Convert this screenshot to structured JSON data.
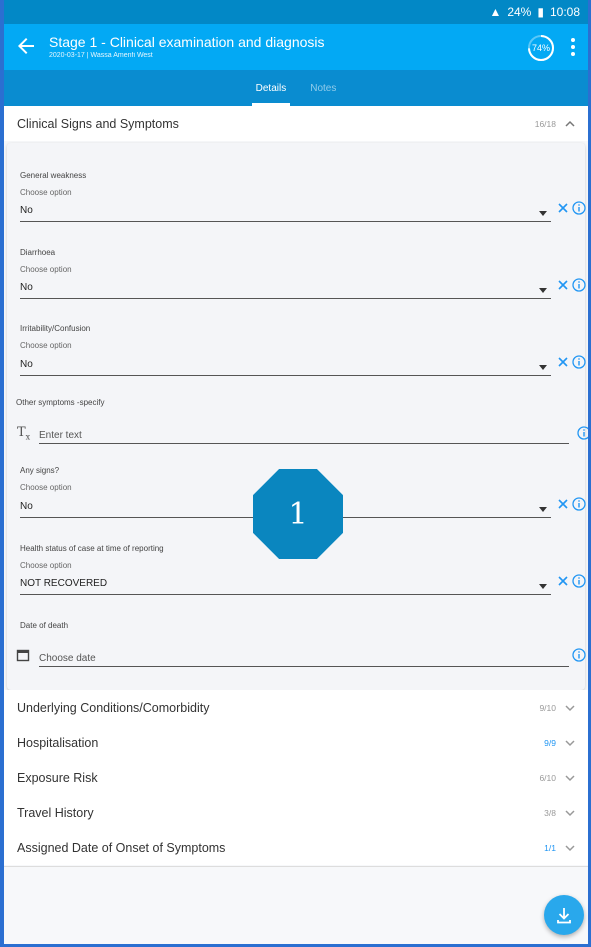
{
  "status_bar": {
    "battery": "24%",
    "time": "10:08"
  },
  "app_bar": {
    "title": "Stage 1 - Clinical examination and diagnosis",
    "subtitle": "2020-03-17 | Wassa Amenfi West",
    "progress": "74%"
  },
  "tabs": [
    {
      "label": "Details"
    },
    {
      "label": "Notes"
    }
  ],
  "sections": {
    "clinical": {
      "title": "Clinical Signs and Symptoms",
      "count": "16/18"
    },
    "underlying": {
      "title": "Underlying Conditions/Comorbidity",
      "count": "9/10"
    },
    "hospitalisation": {
      "title": "Hospitalisation",
      "count": "9/9"
    },
    "exposure": {
      "title": "Exposure Risk",
      "count": "6/10"
    },
    "travel": {
      "title": "Travel History",
      "count": "3/8"
    },
    "onset": {
      "title": "Assigned Date of Onset of Symptoms",
      "count": "1/1"
    }
  },
  "fields": {
    "weakness": {
      "label": "General weakness",
      "sublabel": "Choose option",
      "value": "No"
    },
    "diarrhoea": {
      "label": "Diarrhoea",
      "sublabel": "Choose option",
      "value": "No"
    },
    "irritability": {
      "label": "Irritability/Confusion",
      "sublabel": "Choose option",
      "value": "No"
    },
    "other": {
      "label": "Other symptoms -specify",
      "placeholder": "Enter text",
      "icon": "Tx"
    },
    "signs": {
      "label": "Any signs?",
      "sublabel": "Choose option",
      "value": "No"
    },
    "health": {
      "label": "Health status of case at time of reporting",
      "sublabel": "Choose option",
      "value": "NOT RECOVERED"
    },
    "death": {
      "label": "Date of death",
      "placeholder": "Choose date"
    }
  },
  "badge": "1",
  "colors": {
    "primary": "#03a9f4",
    "accent": "#2196f3",
    "dark": "#0288c6"
  }
}
